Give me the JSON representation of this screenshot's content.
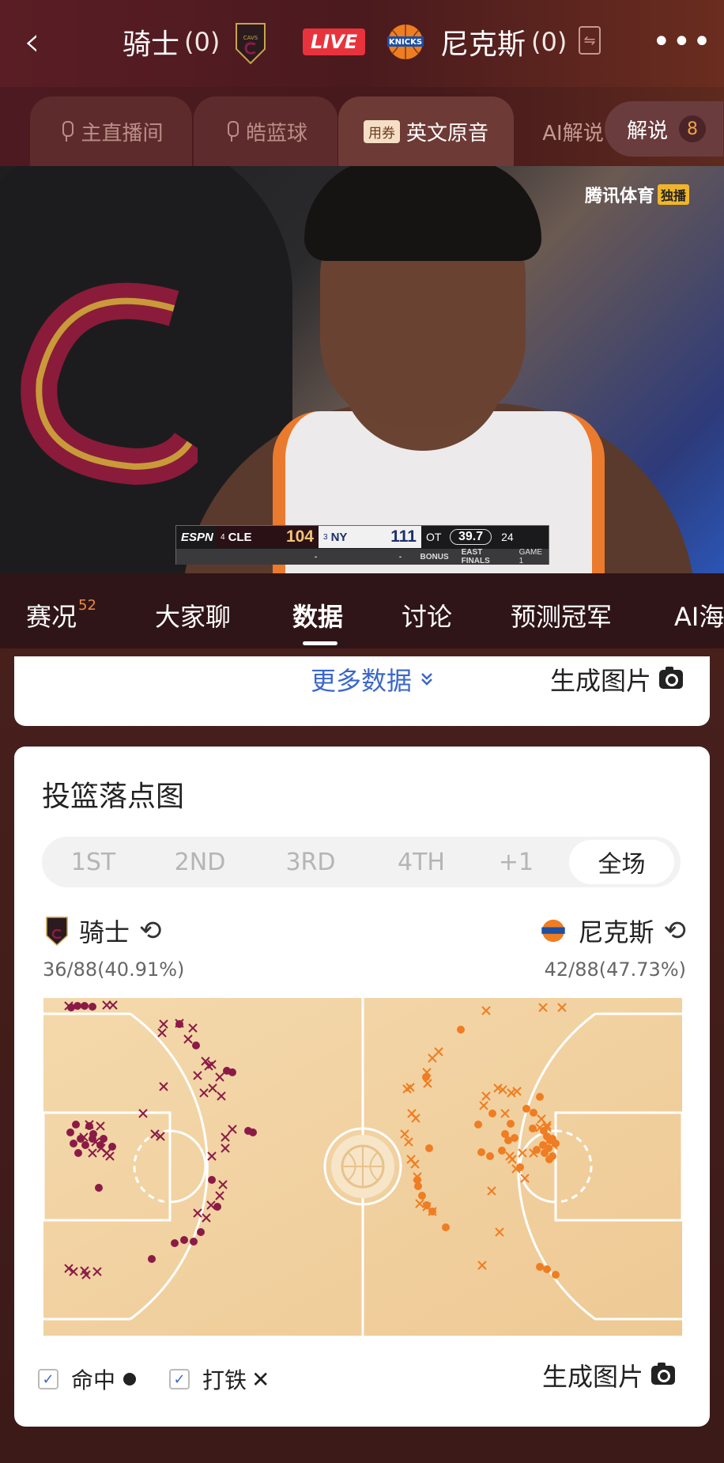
{
  "header": {
    "back": "‹",
    "home": {
      "name": "骑士",
      "score": "(0)"
    },
    "live": "LIVE",
    "away": {
      "name": "尼克斯",
      "score": "(0)"
    },
    "more": "•••"
  },
  "channels": {
    "items": [
      {
        "label": "主直播间"
      },
      {
        "label": "皓蓝球"
      },
      {
        "label": "英文原音",
        "coupon": "用券"
      },
      {
        "label": "AI解说"
      }
    ],
    "commentary": {
      "label": "解说",
      "count": "8"
    }
  },
  "video": {
    "watermark": "腾讯体育",
    "watermark_tag": "独播",
    "scorebug": {
      "network": "ESPN",
      "home": {
        "seed": "4",
        "abbr": "CLE",
        "score": "104"
      },
      "away": {
        "seed": "3",
        "abbr": "NY",
        "score": "111"
      },
      "period": "OT",
      "clock": "39.7",
      "shot_clock": "24",
      "row2": {
        "home": "-",
        "away": "-",
        "bonus": "BONUS",
        "series": "EAST FINALS",
        "game": "GAME 1"
      }
    }
  },
  "tabs": {
    "items": [
      "赛况",
      "大家聊",
      "数据",
      "讨论",
      "预测冠军",
      "AI海"
    ],
    "badge": "52",
    "active": "数据"
  },
  "stats_card": {
    "more_data": "更多数据",
    "generate_image": "生成图片"
  },
  "shot_chart": {
    "title": "投篮落点图",
    "periods": [
      "1ST",
      "2ND",
      "3RD",
      "4TH",
      "+1",
      "全场"
    ],
    "active_period": "全场",
    "home": {
      "name": "骑士",
      "fg": "36/88(40.91%)",
      "color": "#8b1b46"
    },
    "away": {
      "name": "尼克斯",
      "fg": "42/88(47.73%)",
      "color": "#ef7d22"
    },
    "legend": {
      "made": "命中",
      "missed": "打铁"
    },
    "generate_image": "生成图片"
  }
}
